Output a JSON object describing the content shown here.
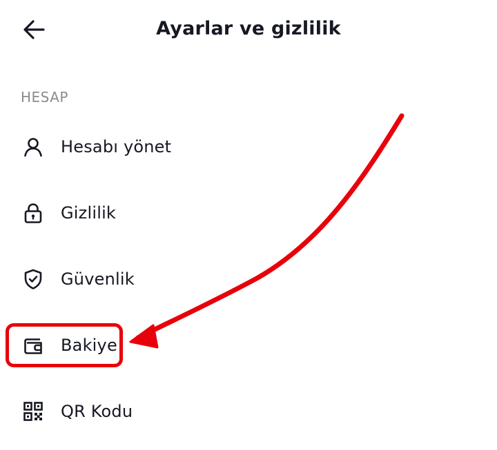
{
  "header": {
    "title": "Ayarlar ve gizlilik",
    "back_icon": "arrow-left-icon"
  },
  "section": {
    "label": "HESAP"
  },
  "menu": {
    "items": [
      {
        "label": "Hesabı yönet",
        "icon": "person-icon"
      },
      {
        "label": "Gizlilik",
        "icon": "lock-icon"
      },
      {
        "label": "Güvenlik",
        "icon": "shield-check-icon"
      },
      {
        "label": "Bakiye",
        "icon": "wallet-icon"
      },
      {
        "label": "QR Kodu",
        "icon": "qr-code-icon"
      }
    ]
  },
  "annotation": {
    "color": "#e8000b",
    "highlighted_item": "Bakiye"
  },
  "colors": {
    "text": "#161823",
    "section_label": "#8a8b91",
    "background": "#ffffff"
  }
}
